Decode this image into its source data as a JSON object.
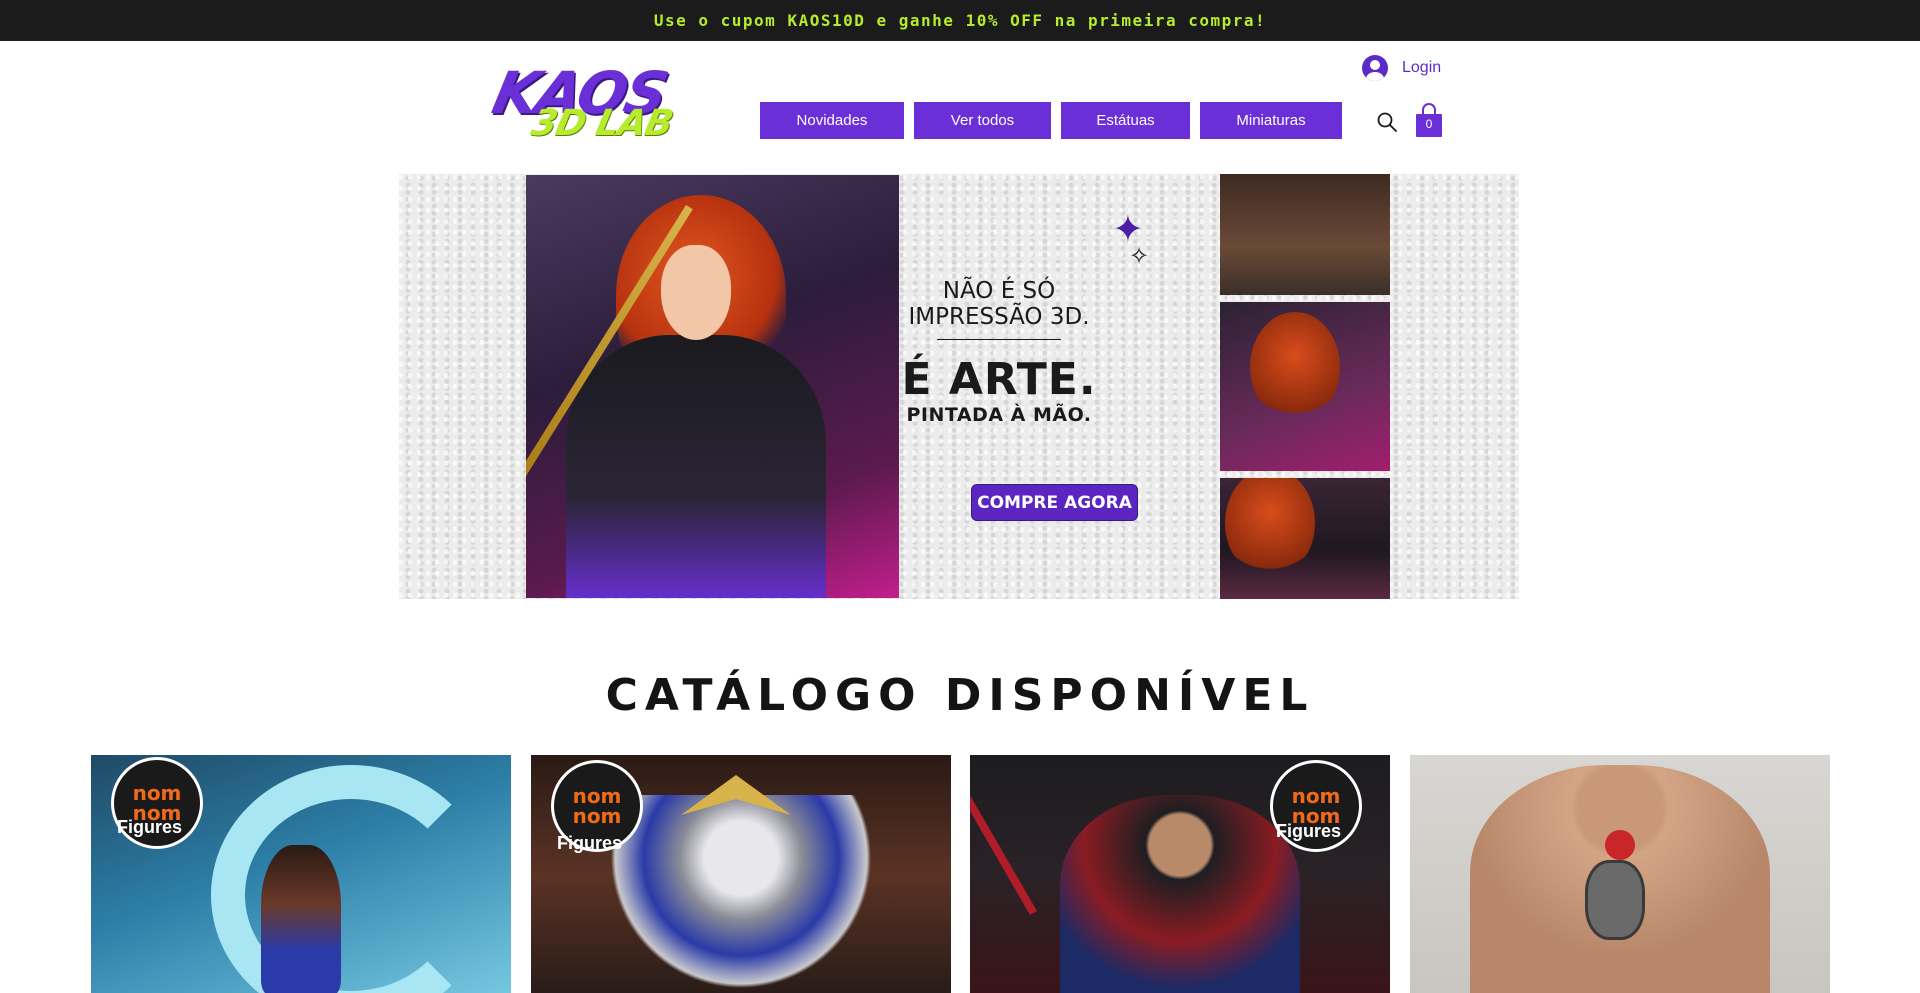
{
  "promo": {
    "text": "Use o cupom KAOS10D e ganhe 10% OFF na primeira compra!"
  },
  "header": {
    "logo": {
      "main": "KAOS",
      "sub": "3D LAB"
    },
    "login_label": "Login",
    "nav": [
      {
        "label": "Novidades"
      },
      {
        "label": "Ver todos"
      },
      {
        "label": "Estátuas"
      },
      {
        "label": "Miniaturas"
      }
    ],
    "cart_count": "0",
    "icons": {
      "search": "search-icon",
      "cart": "cart-icon",
      "account": "account-icon"
    }
  },
  "hero": {
    "line1": "NÃO É SÓ",
    "line2": "IMPRESSÃO 3D.",
    "headline": "É ARTE.",
    "subheadline": "PINTADA À MÃO.",
    "cta_label": "COMPRE AGORA"
  },
  "catalog": {
    "title": "CATÁLOGO DISPONÍVEL",
    "products": [
      {
        "badge_top": "nom",
        "badge_bottom": "nom",
        "badge_sub": "Figures"
      },
      {
        "badge_top": "nom",
        "badge_bottom": "nom",
        "badge_sub": "Figures"
      },
      {
        "badge_top": "nom",
        "badge_bottom": "nom",
        "badge_sub": "Figures"
      },
      {}
    ]
  },
  "colors": {
    "brand_purple": "#6a2fd6",
    "brand_lime": "#b6ec2c",
    "promo_bg": "#1b1b1b"
  }
}
